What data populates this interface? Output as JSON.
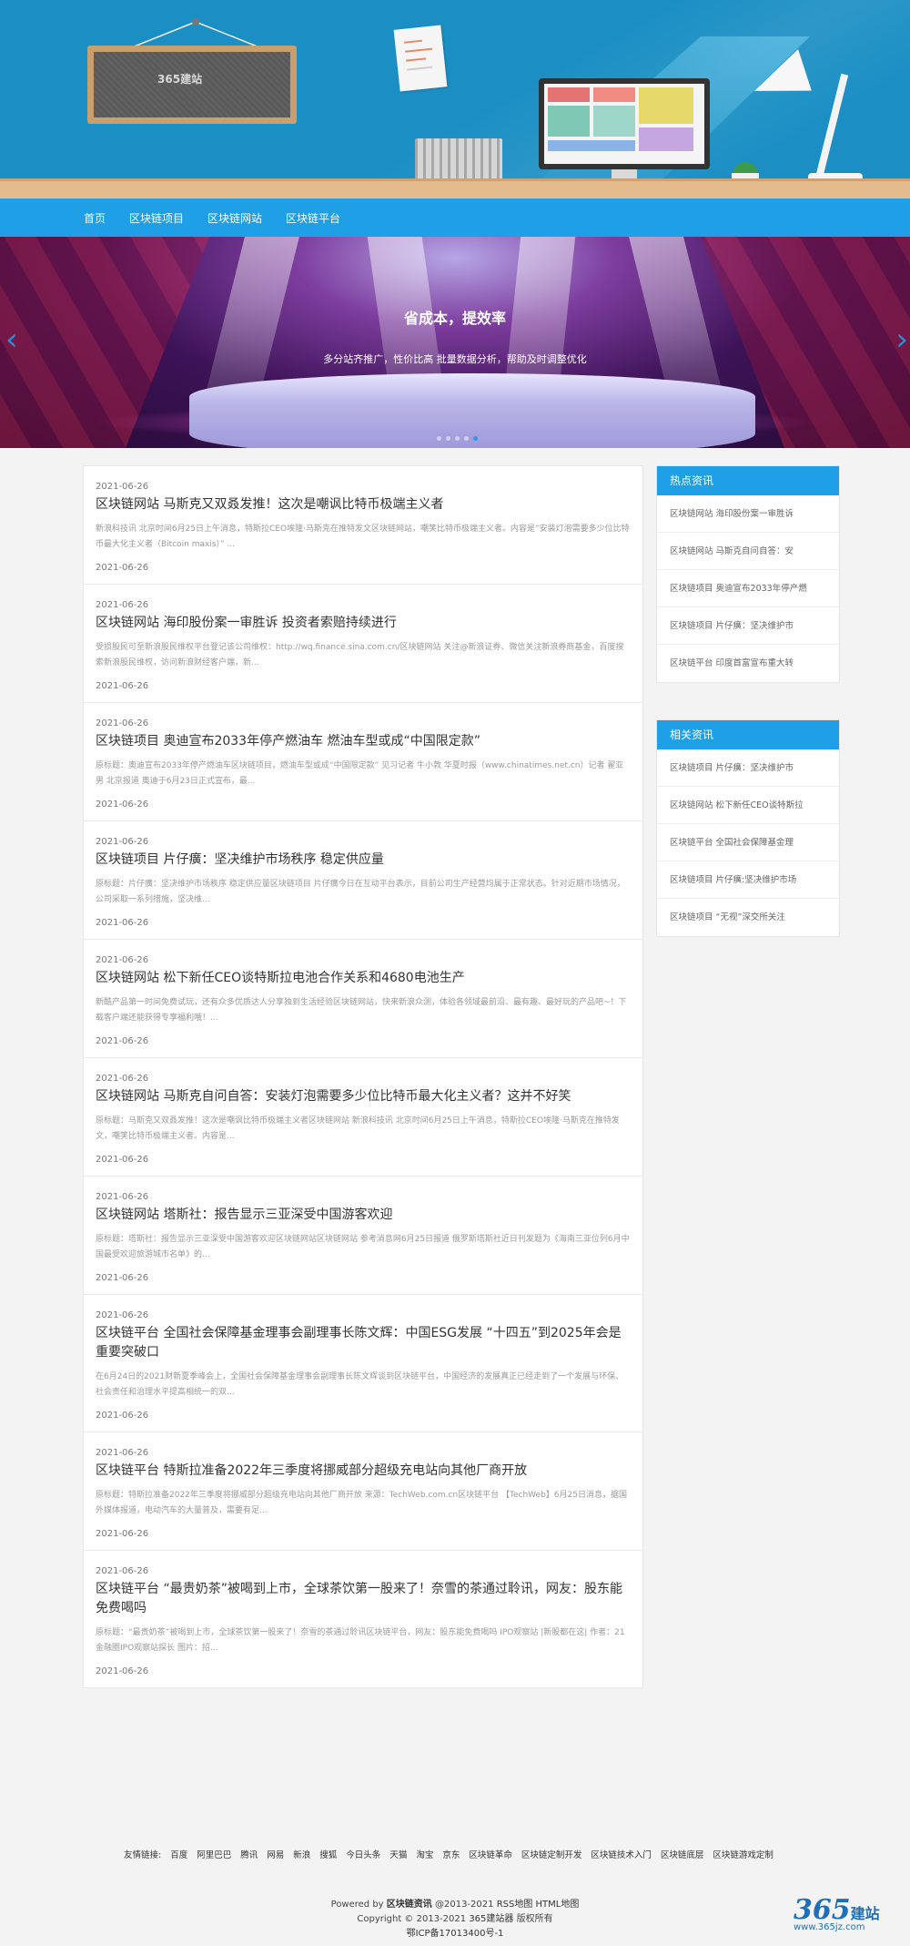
{
  "header": {
    "logo_text": "365",
    "logo_suffix": "建站"
  },
  "nav": {
    "items": [
      "首页",
      "区块链项目",
      "区块链网站",
      "区块链平台"
    ]
  },
  "banner": {
    "title": "省成本，提效率",
    "subtitle": "多分站齐推广，性价比高 批量数据分析，帮助及时调整优化",
    "prev": "‹",
    "next": "›",
    "slides": 5,
    "active_slide": 5
  },
  "articles": [
    {
      "date": "2021-06-26",
      "title": "区块链网站 马斯克又双叒发推！这次是嘲讽比特币极端主义者",
      "summary": "新浪科技讯 北京时间6月25日上午消息，特斯拉CEO埃隆·马斯克在推特发文区块链网站，嘲笑比特币极端主义者。内容是“安装灯泡需要多少位比特币最大化主义者（Bitcoin maxis）” ...",
      "date2": "2021-06-26"
    },
    {
      "date": "2021-06-26",
      "title": "区块链网站 海印股份案一审胜诉 投资者索赔持续进行",
      "summary": "受损股民可至新浪股民维权平台登记该公司维权：http://wq.finance.sina.com.cn/区块链网站 关注@新浪证券、微信关注新浪券商基金，百度搜索新浪股民维权，访问新浪财经客户端，新...",
      "date2": "2021-06-26"
    },
    {
      "date": "2021-06-26",
      "title": "区块链项目 奥迪宣布2033年停产燃油车 燃油车型或成“中国限定款”",
      "summary": "原标题：奥迪宣布2033年停产燃油车区块链项目，燃油车型或成“中国限定款” 见习记者 牛小敦 华夏时报（www.chinatimes.net.cn）记者 翟亚男 北京报道 奥迪于6月23日正式宣布，最...",
      "date2": "2021-06-26"
    },
    {
      "date": "2021-06-26",
      "title": "区块链项目 片仔癀：坚决维护市场秩序 稳定供应量",
      "summary": "原标题：片仔癀：坚决维护市场秩序 稳定供应量区块链项目 片仔癀今日在互动平台表示，目前公司生产经营均属于正常状态。针对近期市场情况，公司采取一系列措施，坚决维...",
      "date2": "2021-06-26"
    },
    {
      "date": "2021-06-26",
      "title": "区块链网站 松下新任CEO谈特斯拉电池合作关系和4680电池生产",
      "summary": "新酷产品第一时间免费试玩，还有众多优质达人分享独到生活经验区块链网站，快来新浪众测，体验各领域最前沿、最有趣、最好玩的产品吧~！下载客户端还能获得专享福利哦！...",
      "date2": "2021-06-26"
    },
    {
      "date": "2021-06-26",
      "title": "区块链网站 马斯克自问自答：安装灯泡需要多少位比特币最大化主义者？这并不好笑",
      "summary": "原标题：马斯克又双叒发推！这次是嘲讽比特币极端主义者区块链网站 新浪科技讯 北京时间6月25日上午消息，特斯拉CEO埃隆·马斯克在推特发文，嘲笑比特币极端主义者。内容是...",
      "date2": "2021-06-26"
    },
    {
      "date": "2021-06-26",
      "title": "区块链网站 塔斯社：报告显示三亚深受中国游客欢迎",
      "summary": "原标题：塔斯社：报告显示三亚深受中国游客欢迎区块链网站区块链网站 参考消息网6月25日报道 俄罗斯塔斯社近日刊发题为《海南三亚位列6月中国最受欢迎旅游城市名单》的...",
      "date2": "2021-06-26"
    },
    {
      "date": "2021-06-26",
      "title": "区块链平台 全国社会保障基金理事会副理事长陈文辉：中国ESG发展 “十四五”到2025年会是重要突破口",
      "summary": "在6月24日的2021财新夏季峰会上，全国社会保障基金理事会副理事长陈文辉谈到区块链平台，中国经济的发展真正已经走到了一个发展与环保、社会责任和治理水平提高相统一的双...",
      "date2": "2021-06-26"
    },
    {
      "date": "2021-06-26",
      "title": "区块链平台 特斯拉准备2022年三季度将挪威部分超级充电站向其他厂商开放",
      "summary": "原标题：特斯拉准备2022年三季度将挪威部分超级充电站向其他厂商开放 来源：TechWeb.com.cn区块链平台 【TechWeb】6月25日消息，据国外媒体报道，电动汽车的大量普及，需要有足...",
      "date2": "2021-06-26"
    },
    {
      "date": "2021-06-26",
      "title": "区块链平台 “最贵奶茶”被喝到上市，全球茶饮第一股来了！奈雪的茶通过聆讯，网友：股东能免费喝吗",
      "summary": "原标题：“最贵奶茶”被喝到上市，全球茶饮第一股来了！奈雪的茶通过聆讯区块链平台，网友：股东能免费喝吗 IPO观察站 |新股都在这| 作者：21金融圈IPO观察站探长 图片：招...",
      "date2": "2021-06-26"
    }
  ],
  "hot": {
    "title": "热点资讯",
    "items": [
      "区块链网站 海印股份案一审胜诉",
      "区块链网站 马斯克自问自答：安",
      "区块链项目 奥迪宣布2033年停产燃",
      "区块链项目 片仔癀：坚决维护市",
      "区块链平台 印度首富宣布重大转"
    ]
  },
  "related": {
    "title": "相关资讯",
    "items": [
      "区块链项目 片仔癀：坚决维护市",
      "区块链网站 松下新任CEO谈特斯拉",
      "区块链平台 全国社会保障基金理",
      "区块链项目 片仔癀:坚决维护市场",
      "区块链项目 “无视”深交所关注"
    ]
  },
  "friends": {
    "label": "友情链接:",
    "links": [
      "百度",
      "阿里巴巴",
      "腾讯",
      "网易",
      "新浪",
      "搜狐",
      "今日头条",
      "天猫",
      "淘宝",
      "京东",
      "区块链革命",
      "区块链定制开发",
      "区块链技术入门",
      "区块链底层",
      "区块链游戏定制"
    ]
  },
  "footer": {
    "powered_prefix": "Powered by",
    "powered_link": "区块链资讯",
    "powered_year": "@2013-2021",
    "rss": "RSS地图",
    "html": "HTML地图",
    "copyright_prefix": "Copyright © 2013-2021",
    "copyright_link": "365建站器",
    "copyright_suffix": "版权所有",
    "icp": "鄂ICP备17013400号-1"
  },
  "watermark": {
    "number": "365",
    "cn": "建站",
    "url": "www.365jz.com"
  },
  "colors": {
    "nav": "#1e9fe6",
    "header": "#1b8fc4",
    "accent": "#1e9fe6"
  }
}
